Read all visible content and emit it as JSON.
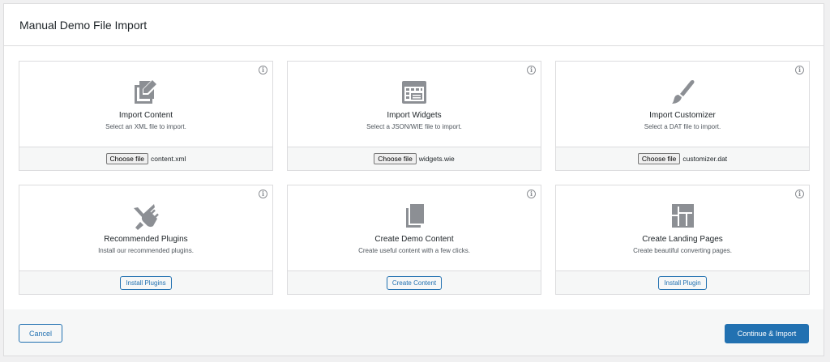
{
  "modal": {
    "title": "Manual Demo File Import"
  },
  "cards": {
    "import_content": {
      "title": "Import Content",
      "description": "Select an XML file to import.",
      "button": "Choose file",
      "file": "content.xml",
      "icon": "edit-page-icon",
      "info": "i"
    },
    "import_widgets": {
      "title": "Import Widgets",
      "description": "Select a JSON/WIE file to import.",
      "button": "Choose file",
      "file": "widgets.wie",
      "icon": "widgets-icon",
      "info": "i"
    },
    "import_customizer": {
      "title": "Import Customizer",
      "description": "Select a DAT file to import.",
      "button": "Choose file",
      "file": "customizer.dat",
      "icon": "paintbrush-icon",
      "info": "i"
    },
    "recommended_plugins": {
      "title": "Recommended Plugins",
      "description": "Install our recommended plugins.",
      "button": "Install Plugins",
      "icon": "plugin-icon",
      "info": "i"
    },
    "create_demo_content": {
      "title": "Create Demo Content",
      "description": "Create useful content with a few clicks.",
      "button": "Create Content",
      "icon": "pages-icon",
      "info": "i"
    },
    "create_landing_pages": {
      "title": "Create Landing Pages",
      "description": "Create beautiful converting pages.",
      "button": "Install Plugin",
      "icon": "layout-icon",
      "info": "i"
    }
  },
  "footer": {
    "cancel": "Cancel",
    "continue": "Continue & Import"
  },
  "colors": {
    "accent": "#2271b1",
    "icon": "#8c8f94",
    "border": "#dcdcde"
  }
}
